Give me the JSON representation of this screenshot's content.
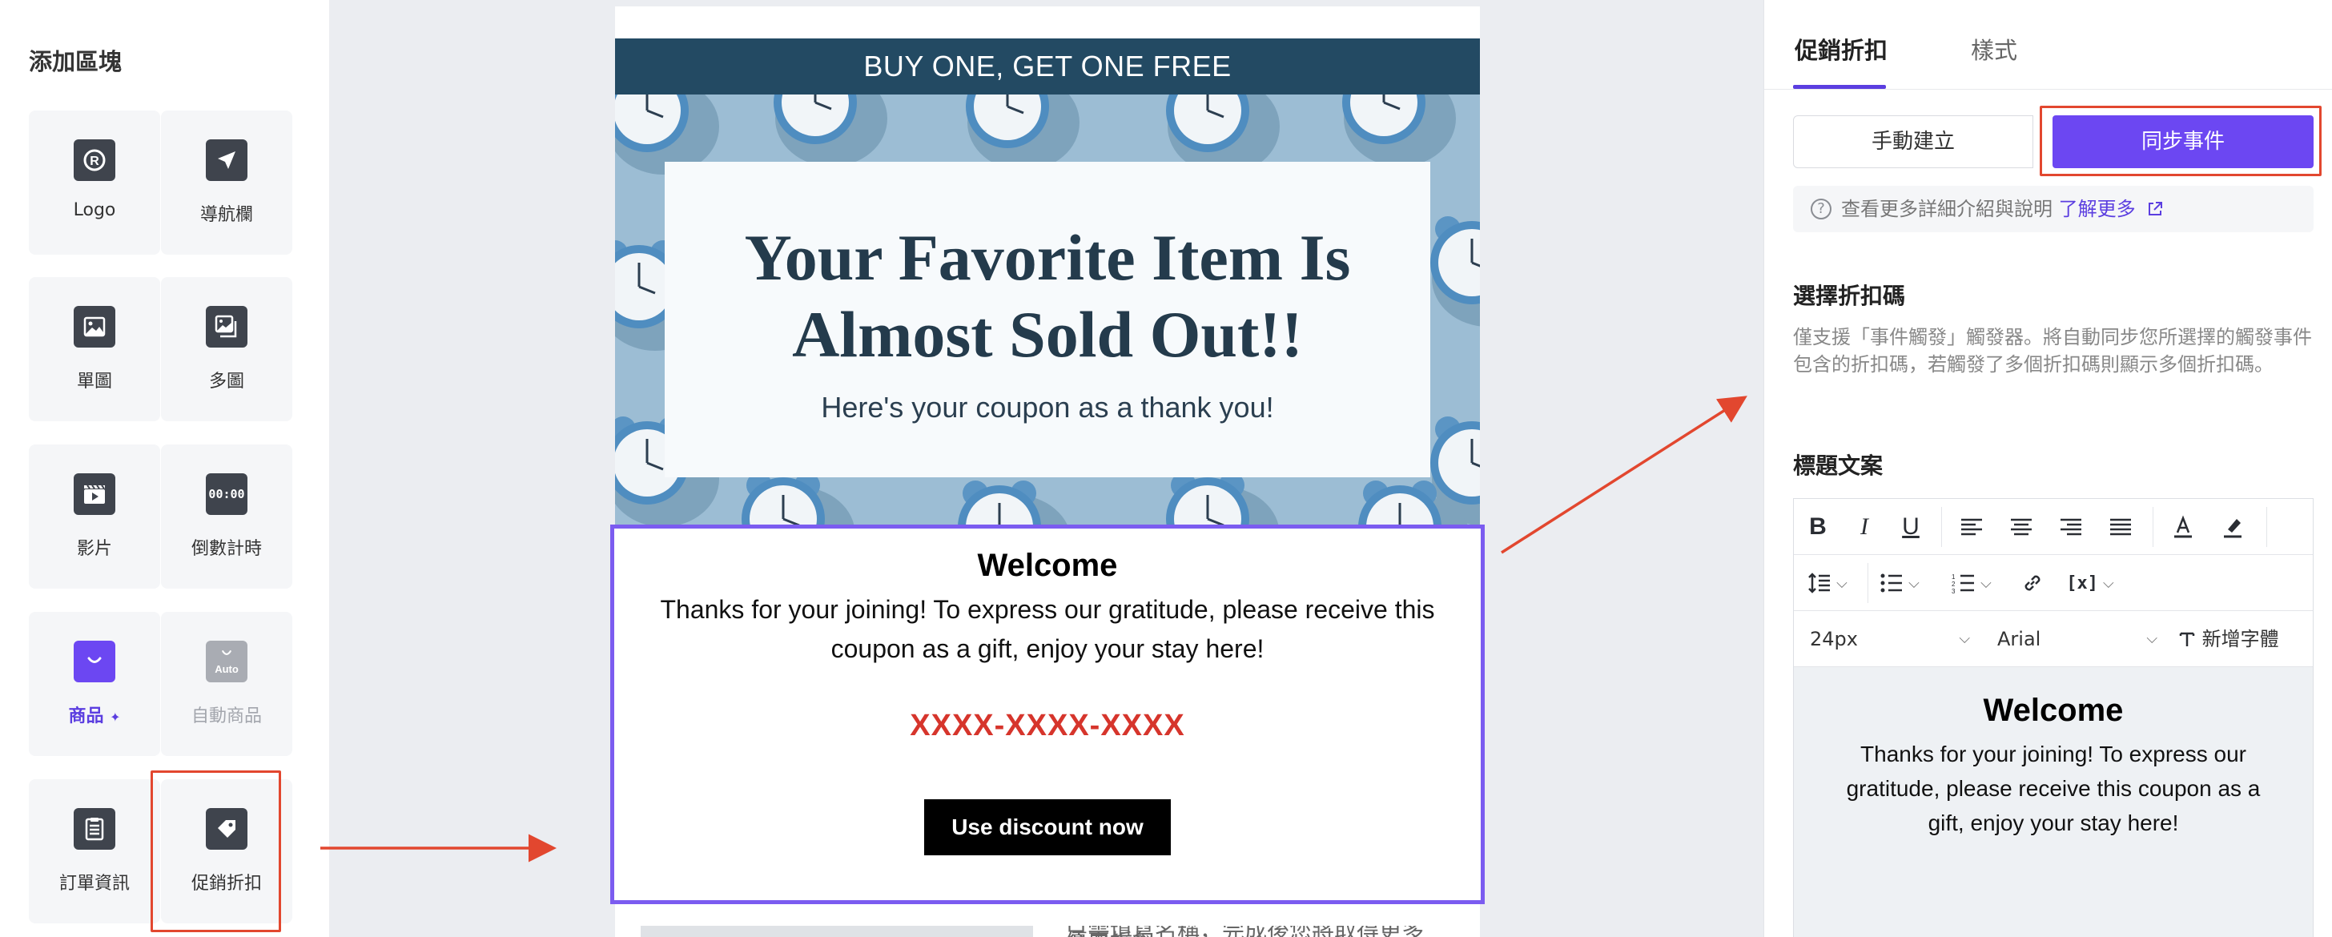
{
  "left_panel": {
    "title": "添加區塊",
    "blocks": [
      {
        "label": "Logo",
        "icon": "logo-icon"
      },
      {
        "label": "導航欄",
        "icon": "navigation-arrow-icon"
      },
      {
        "label": "單圖",
        "icon": "single-image-icon"
      },
      {
        "label": "多圖",
        "icon": "multi-image-icon"
      },
      {
        "label": "影片",
        "icon": "video-icon"
      },
      {
        "label": "倒數計時",
        "icon": "countdown-icon",
        "digits": "00:00"
      },
      {
        "label": "商品",
        "icon": "shopping-bag-icon",
        "sparkle": "✦"
      },
      {
        "label": "自動商品",
        "icon": "auto-product-icon",
        "badge": "Auto"
      },
      {
        "label": "訂單資訊",
        "icon": "order-info-icon"
      },
      {
        "label": "促銷折扣",
        "icon": "discount-tag-icon"
      }
    ]
  },
  "email": {
    "banner": "BUY ONE, GET ONE FREE",
    "hero_title": "Your Favorite Item Is Almost Sold Out!!",
    "hero_subtitle": "Here's your coupon as a thank you!",
    "coupon_heading": "Welcome",
    "coupon_body": "Thanks for your joining! To express our gratitude, please receive this coupon as a gift, enjoy your stay here!",
    "coupon_code": "XXXX-XXXX-XXXX",
    "button_label": "Use discount now",
    "below_text": "只需填寫名稱，完成後您將取得更多優惠折扣"
  },
  "right_panel": {
    "tabs": [
      "促銷折扣",
      "樣式"
    ],
    "active_tab": "促銷折扣",
    "mode_manual": "手動建立",
    "mode_sync": "同步事件",
    "active_mode": "同步事件",
    "help_text": "查看更多詳細介紹與說明",
    "learn_more": "了解更多",
    "select_code_title": "選擇折扣碼",
    "select_code_desc": "僅支援「事件觸發」觸發器。將自動同步您所選擇的觸發事件包含的折扣碼，若觸發了多個折扣碼則顯示多個折扣碼。",
    "headline_title": "標題文案",
    "font_size": "24px",
    "font_family": "Arial",
    "add_font": "新增字體",
    "variable_label": "[x]",
    "preview_heading": "Welcome",
    "preview_body": "Thanks for your joining! To express our gratitude, please receive this coupon as a gift, enjoy your stay here!"
  },
  "colors": {
    "accent_purple": "#6c47f2",
    "highlight_red": "#e2472f",
    "banner_navy": "#234a63",
    "coupon_red": "#d6352c"
  }
}
